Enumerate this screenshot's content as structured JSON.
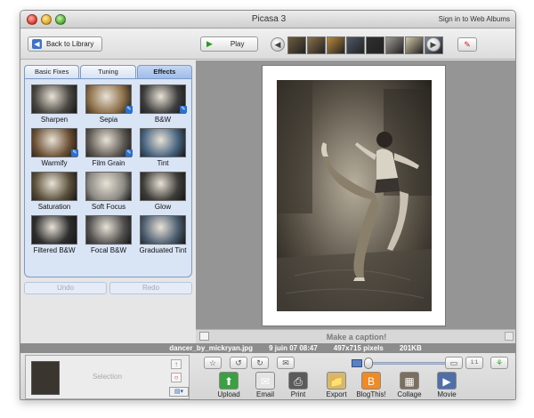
{
  "window": {
    "title": "Picasa 3",
    "sign_in": "Sign in to Web Albums"
  },
  "toolbar": {
    "back_label": "Back to Library",
    "play_label": "Play",
    "filmstrip": [
      "#6e5c3c",
      "#8a7048",
      "#b98a3c",
      "#4d5867",
      "#2f2f2f",
      "#a09a92",
      "#d2c7a6",
      "#7c8ca2"
    ]
  },
  "left_panel": {
    "tabs": [
      "Basic Fixes",
      "Tuning",
      "Effects"
    ],
    "active_tab": "Effects",
    "effects": [
      {
        "label": "Sharpen",
        "color": "#4a4742"
      },
      {
        "label": "Sepia",
        "color": "#8b6d46"
      },
      {
        "label": "B&W",
        "color": "#3c3c3c"
      },
      {
        "label": "Warmify",
        "color": "#6c5034"
      },
      {
        "label": "Film Grain",
        "color": "#5f5a54"
      },
      {
        "label": "Tint",
        "color": "#44627e"
      },
      {
        "label": "Saturation",
        "color": "#5a4f3a"
      },
      {
        "label": "Soft Focus",
        "color": "#8d8a84"
      },
      {
        "label": "Glow",
        "color": "#3f3d39"
      },
      {
        "label": "Filtered B&W",
        "color": "#2e2e2e"
      },
      {
        "label": "Focal B&W",
        "color": "#535050"
      },
      {
        "label": "Graduated Tint",
        "color": "#4b5d6f"
      }
    ],
    "undo_label": "Undo",
    "redo_label": "Redo"
  },
  "viewer": {
    "caption_placeholder": "Make a caption!"
  },
  "info": {
    "filename": "dancer_by_mickryan.jpg",
    "date": "9 juin 07 08:47",
    "dimensions": "497x715 pixels",
    "size": "201KB"
  },
  "tray": {
    "label": "Selection"
  },
  "actions": [
    {
      "label": "Upload",
      "color": "#3aa041"
    },
    {
      "label": "Email",
      "color": "#e4e4e4"
    },
    {
      "label": "Print",
      "color": "#5b5b5b"
    },
    {
      "label": "Export",
      "color": "#d7b86b"
    },
    {
      "label": "BlogThis!",
      "color": "#f08a24"
    },
    {
      "label": "Collage",
      "color": "#7c6f5d"
    },
    {
      "label": "Movie",
      "color": "#4f6fa8"
    }
  ]
}
